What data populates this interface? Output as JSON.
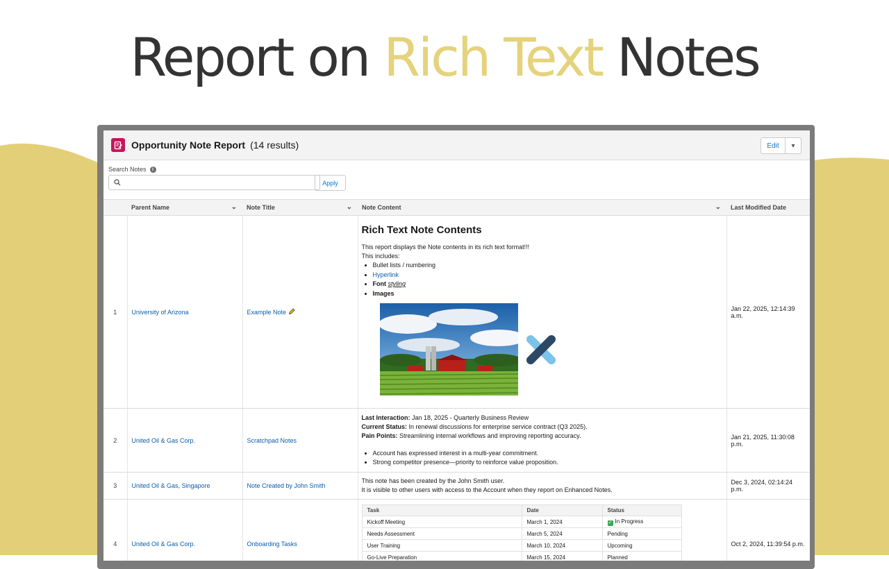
{
  "hero": {
    "part1": "Report on",
    "part2": "Rich Text",
    "part3": "Notes",
    "accent_color": "#e5d27c"
  },
  "card": {
    "title": "Opportunity Note Report",
    "count": "(14 results)",
    "edit_label": "Edit",
    "icon": "note-icon"
  },
  "search": {
    "label": "Search Notes",
    "value": "",
    "apply_label": "Apply"
  },
  "table": {
    "columns": [
      "Parent Name",
      "Note Title",
      "Note Content",
      "Last Modified Date"
    ],
    "rows": [
      {
        "num": "1",
        "parent": "University of Arizona",
        "title": "Example Note",
        "date": "Jan 22, 2025, 12:14:39 a.m."
      },
      {
        "num": "2",
        "parent": "United Oil & Gas Corp.",
        "title": "Scratchpad Notes",
        "date": "Jan 21, 2025, 11:30:08 p.m."
      },
      {
        "num": "3",
        "parent": "United Oil & Gas, Singapore",
        "title": "Note Created by John Smith",
        "date": "Dec 3, 2024, 02:14:24 p.m."
      },
      {
        "num": "4",
        "parent": "United Oil & Gas Corp.",
        "title": "Onboarding Tasks",
        "date": "Oct 2, 2024, 11:39:54 p.m."
      }
    ]
  },
  "note1": {
    "heading": "Rich Text Note Contents",
    "line1": "This report displays the Note contents in its rich text format!!!",
    "line2": "This includes:",
    "bullet1": "Bullet lists / numbering",
    "bullet2": "Hyperlink",
    "bullet3a": "Font",
    "bullet3b": "styling",
    "bullet4": "Images"
  },
  "note2": {
    "l1_label": "Last Interaction:",
    "l1_text": "Jan 18, 2025 - Quarterly Business Review",
    "l2_label": "Current Status:",
    "l2_text": "In renewal discussions for enterprise service contract (Q3 2025).",
    "l3_label": "Pain Points:",
    "l3_text": "Streamlining internal workflows and improving reporting accuracy.",
    "b1": "Account has expressed interest in a multi-year commitment.",
    "b2": "Strong competitor presence—priority to reinforce value proposition."
  },
  "note3": {
    "line1": "This note has been created by the John Smith user.",
    "line2": "It is visible to other users with access to the Account when they report on Enhanced Notes."
  },
  "note4": {
    "headers": [
      "Task",
      "Date",
      "Status"
    ],
    "rows": [
      [
        "Kickoff Meeting",
        "March 1, 2024",
        "In Progress"
      ],
      [
        "Needs Assessment",
        "March 5, 2024",
        "Pending"
      ],
      [
        "User Training",
        "March 10, 2024",
        "Upcoming"
      ],
      [
        "Go-Live Preparation",
        "March 15, 2024",
        "Planned"
      ]
    ]
  }
}
